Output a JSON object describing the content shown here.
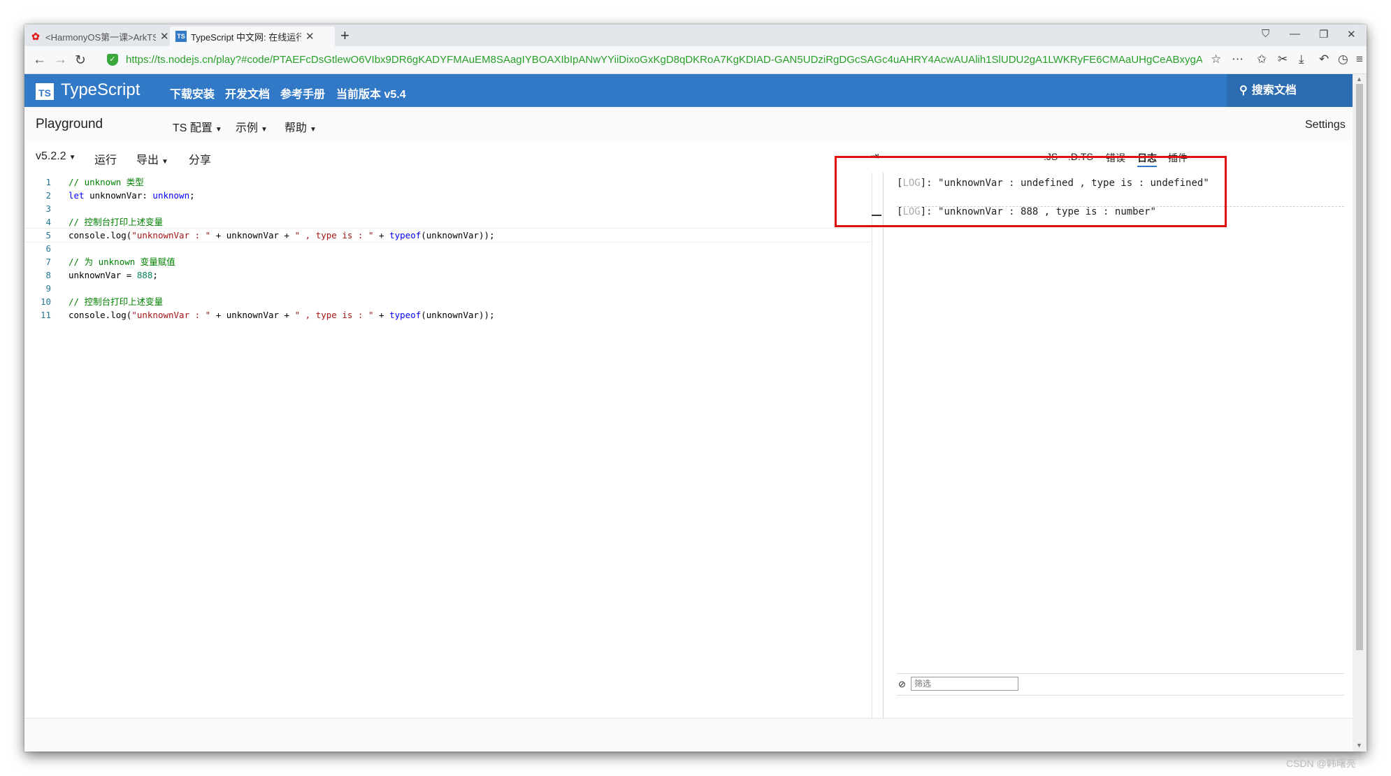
{
  "browser": {
    "tabs": [
      {
        "label": "<HarmonyOS第一课>ArkTS",
        "icon": "huawei-icon"
      },
      {
        "label": "TypeScript 中文网: 在线运行",
        "icon": "ts-icon"
      }
    ],
    "new_tab": "+",
    "url": "https://ts.nodejs.cn/play?#code/PTAEFcDsGtlewO6VIbx9DR6gKADYFMAuEM8SAagIYBOAXIbIpANwYYiiDixoGxKgD8qDKRoA7KgKDIAD-GAN5UDziRgDGcSAGc4uAHRY4AcwAUAlih1SlUDU2gA1LWKRyFE6CMAaUHgCeABxygAlrlN"
  },
  "ts_header": {
    "logo_badge": "TS",
    "brand": "TypeScript",
    "nav": [
      "下载安装",
      "开发文档",
      "参考手册",
      "当前版本 v5.4"
    ],
    "search_label": "搜索文档"
  },
  "playground": {
    "title": "Playground",
    "menus": [
      "TS 配置",
      "示例",
      "帮助"
    ],
    "settings": "Settings"
  },
  "editor_toolbar": {
    "version": "v5.2.2",
    "run": "运行",
    "export": "导出",
    "share": "分享"
  },
  "right_tabs": [
    ".JS",
    ".D.TS",
    "错误",
    "日志",
    "插件"
  ],
  "selected_right_tab": "日志",
  "logs": [
    {
      "tag": "LOG",
      "message": "\"unknownVar : undefined , type is : undefined\""
    },
    {
      "tag": "LOG",
      "message": "\"unknownVar : 888 , type is : number\""
    }
  ],
  "filter_placeholder": "筛选",
  "watermark": "CSDN @韩曙亮",
  "code_lines": [
    "1",
    "2",
    "3",
    "4",
    "5",
    "6",
    "7",
    "8",
    "9",
    "10",
    "11"
  ],
  "code_text": {
    "l1": "// unknown 类型",
    "l2_kw": "let",
    "l2_var": " unknownVar: ",
    "l2_type": "unknown",
    "l2_end": ";",
    "l4": "// 控制台打印上述变量",
    "l5_a": "console.log(",
    "l5_s1": "\"unknownVar : \"",
    "l5_b": " + unknownVar + ",
    "l5_s2": "\" , type is : \"",
    "l5_c": " + ",
    "l5_kw": "typeof",
    "l5_d": "(unknownVar));",
    "l7": "// 为 unknown 变量赋值",
    "l8_a": "unknownVar = ",
    "l8_num": "888",
    "l8_end": ";",
    "l10": "// 控制台打印上述变量",
    "l11_a": "console.log(",
    "l11_s1": "\"unknownVar : \"",
    "l11_b": " + unknownVar + ",
    "l11_s2": "\" , type is : \"",
    "l11_c": " + ",
    "l11_kw": "typeof",
    "l11_d": "(unknownVar));"
  },
  "colors": {
    "ts_blue": "#3178c6",
    "highlight_box": "#e01010"
  }
}
